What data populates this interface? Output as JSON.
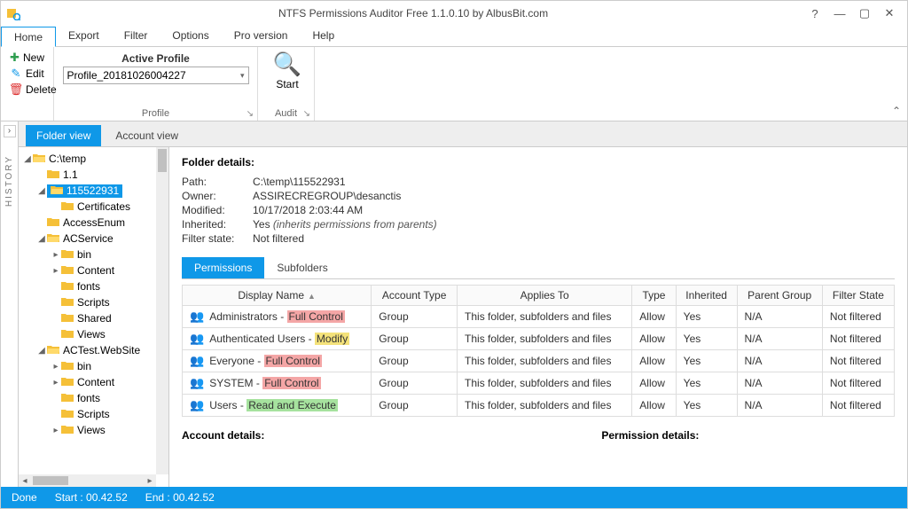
{
  "window": {
    "title": "NTFS Permissions Auditor Free 1.1.0.10 by AlbusBit.com"
  },
  "menu": [
    "Home",
    "Export",
    "Filter",
    "Options",
    "Pro version",
    "Help"
  ],
  "ribbon": {
    "actions": {
      "new": "New",
      "edit": "Edit",
      "delete": "Delete"
    },
    "active_profile_heading": "Active Profile",
    "active_profile_value": "Profile_20181026004227",
    "group_profile": "Profile",
    "start_label": "Start",
    "group_audit": "Audit"
  },
  "history_label": "HISTORY",
  "view_tabs": {
    "folder": "Folder view",
    "account": "Account view"
  },
  "tree": [
    {
      "depth": 0,
      "twisty": "▢→",
      "icon": "folder-open",
      "label": "C:\\temp"
    },
    {
      "depth": 1,
      "twisty": "",
      "icon": "folder",
      "label": "1.1"
    },
    {
      "depth": 1,
      "twisty": "▢→",
      "icon": "folder-open",
      "label": "115522931",
      "selected": true
    },
    {
      "depth": 2,
      "twisty": "",
      "icon": "folder",
      "label": "Certificates"
    },
    {
      "depth": 1,
      "twisty": "",
      "icon": "folder",
      "label": "AccessEnum"
    },
    {
      "depth": 1,
      "twisty": "▢→",
      "icon": "folder-open",
      "label": "ACService"
    },
    {
      "depth": 2,
      "twisty": "▸",
      "icon": "folder",
      "label": "bin"
    },
    {
      "depth": 2,
      "twisty": "▸",
      "icon": "folder",
      "label": "Content"
    },
    {
      "depth": 2,
      "twisty": "",
      "icon": "folder",
      "label": "fonts"
    },
    {
      "depth": 2,
      "twisty": "",
      "icon": "folder",
      "label": "Scripts"
    },
    {
      "depth": 2,
      "twisty": "",
      "icon": "folder",
      "label": "Shared"
    },
    {
      "depth": 2,
      "twisty": "",
      "icon": "folder",
      "label": "Views"
    },
    {
      "depth": 1,
      "twisty": "▢→",
      "icon": "folder-open",
      "label": "ACTest.WebSite"
    },
    {
      "depth": 2,
      "twisty": "▸",
      "icon": "folder",
      "label": "bin"
    },
    {
      "depth": 2,
      "twisty": "▸",
      "icon": "folder",
      "label": "Content"
    },
    {
      "depth": 2,
      "twisty": "",
      "icon": "folder",
      "label": "fonts"
    },
    {
      "depth": 2,
      "twisty": "",
      "icon": "folder",
      "label": "Scripts"
    },
    {
      "depth": 2,
      "twisty": "▸",
      "icon": "folder",
      "label": "Views"
    }
  ],
  "folder_details": {
    "heading": "Folder details:",
    "path_k": "Path:",
    "path_v": "C:\\temp\\115522931",
    "owner_k": "Owner:",
    "owner_v": "ASSIRECREGROUP\\desanctis",
    "modified_k": "Modified:",
    "modified_v": "10/17/2018 2:03:44 AM",
    "inherited_k": "Inherited:",
    "inherited_v": "Yes",
    "inherited_note": "(inherits permissions from parents)",
    "filter_k": "Filter state:",
    "filter_v": "Not filtered"
  },
  "sub_tabs": {
    "permissions": "Permissions",
    "subfolders": "Subfolders"
  },
  "perm_cols": [
    "Display Name",
    "Account Type",
    "Applies To",
    "Type",
    "Inherited",
    "Parent Group",
    "Filter State"
  ],
  "perm_rows": [
    {
      "name": "Administrators",
      "perm": "Full Control",
      "perm_class": "hl-red",
      "account": "Group",
      "applies": "This folder, subfolders and files",
      "type": "Allow",
      "inherited": "Yes",
      "parent": "N/A",
      "filter": "Not filtered"
    },
    {
      "name": "Authenticated Users",
      "perm": "Modify",
      "perm_class": "hl-yellow",
      "account": "Group",
      "applies": "This folder, subfolders and files",
      "type": "Allow",
      "inherited": "Yes",
      "parent": "N/A",
      "filter": "Not filtered"
    },
    {
      "name": "Everyone",
      "perm": "Full Control",
      "perm_class": "hl-red",
      "account": "Group",
      "applies": "This folder, subfolders and files",
      "type": "Allow",
      "inherited": "Yes",
      "parent": "N/A",
      "filter": "Not filtered"
    },
    {
      "name": "SYSTEM",
      "perm": "Full Control",
      "perm_class": "hl-red",
      "account": "Group",
      "applies": "This folder, subfolders and files",
      "type": "Allow",
      "inherited": "Yes",
      "parent": "N/A",
      "filter": "Not filtered"
    },
    {
      "name": "Users",
      "perm": "Read and Execute",
      "perm_class": "hl-green",
      "account": "Group",
      "applies": "This folder, subfolders and files",
      "type": "Allow",
      "inherited": "Yes",
      "parent": "N/A",
      "filter": "Not filtered"
    }
  ],
  "account_details_h": "Account details:",
  "permission_details_h": "Permission details:",
  "status": {
    "done": "Done",
    "start": "Start :  00.42.52",
    "end": "End :  00.42.52"
  }
}
